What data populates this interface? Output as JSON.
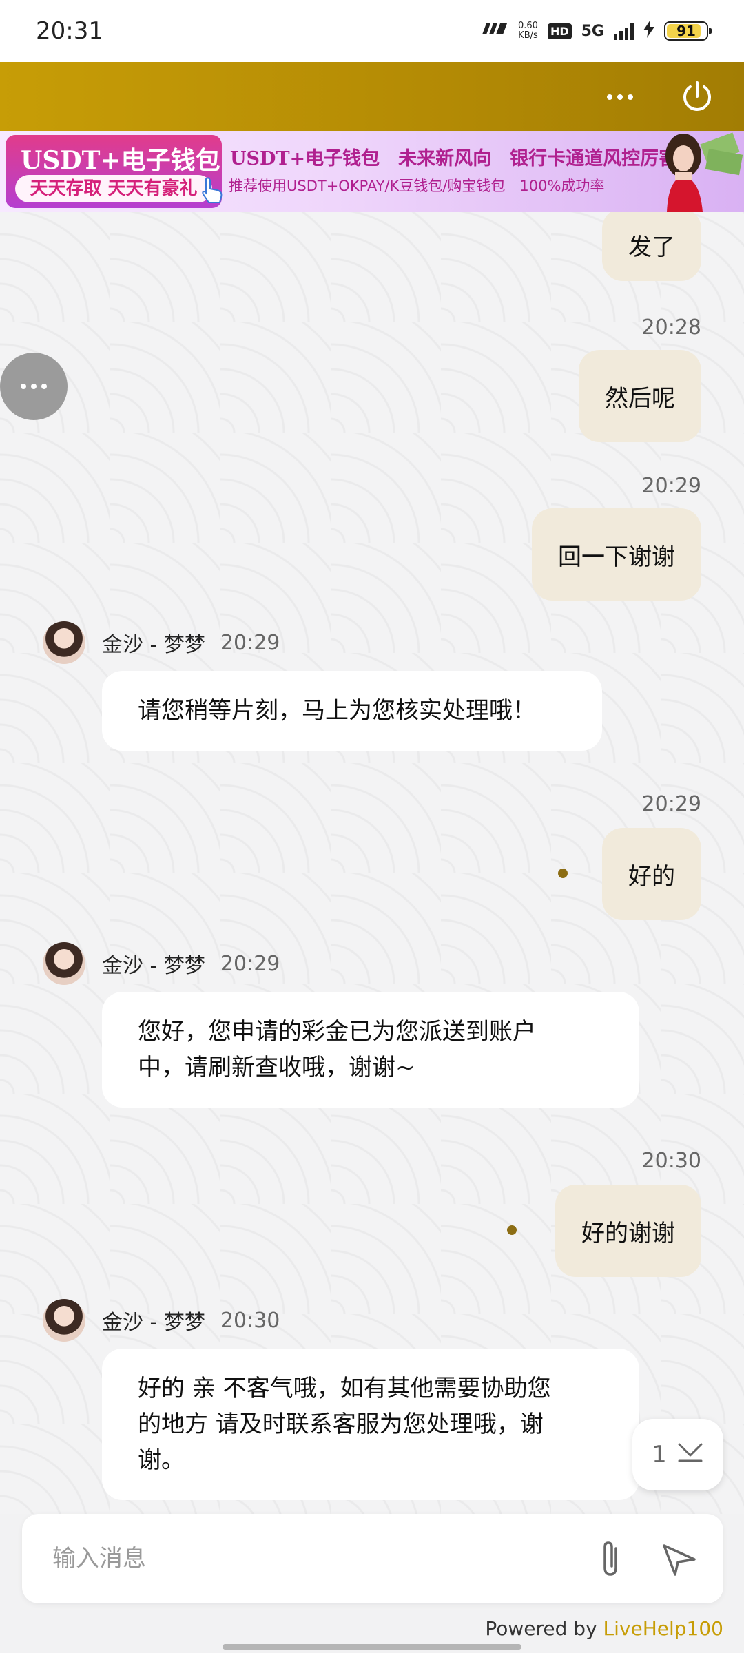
{
  "status_bar": {
    "time": "20:31",
    "speed_value": "0.60",
    "speed_unit": "KB/s",
    "hd": "HD",
    "network": "5G",
    "battery": "91"
  },
  "banner": {
    "left_title": "USDT+电子钱包",
    "left_sub": "天天存取 天天有豪礼",
    "title": "USDT+电子钱包　未来新风向　银行卡通道风控厉害",
    "subtitle": "推荐使用USDT+OKPAY/K豆钱包/购宝钱包　100%成功率"
  },
  "messages": {
    "m0": {
      "text": "发了"
    },
    "m1": {
      "time": "20:28",
      "text": "然后呢"
    },
    "m2": {
      "time": "20:29",
      "text": "回一下谢谢"
    },
    "m3": {
      "name": "金沙 - 梦梦",
      "time": "20:29",
      "text": "请您稍等片刻，马上为您核实处理哦！"
    },
    "m4": {
      "time": "20:29",
      "text": "好的"
    },
    "m5": {
      "name": "金沙 - 梦梦",
      "time": "20:29",
      "line1": "您好，您申请的彩金已为您派送到账户",
      "line2": "中，请刷新查收哦，谢谢~"
    },
    "m6": {
      "time": "20:30",
      "text": "好的谢谢"
    },
    "m7": {
      "name": "金沙 - 梦梦",
      "time": "20:30",
      "line1": "好的 亲 不客气哦，如有其他需要协助您",
      "line2": "的地方 请及时联系客服为您处理哦，谢",
      "line3": "谢。"
    }
  },
  "scroll_button": {
    "count": "1"
  },
  "input": {
    "placeholder": "输入消息"
  },
  "footer": {
    "powered_prefix": "Powered by ",
    "brand": "LiveHelp100"
  },
  "colors": {
    "header": "#b88f05",
    "outgoing_bubble": "#f1eadb",
    "incoming_bubble": "#ffffff",
    "brand": "#c79d06"
  }
}
